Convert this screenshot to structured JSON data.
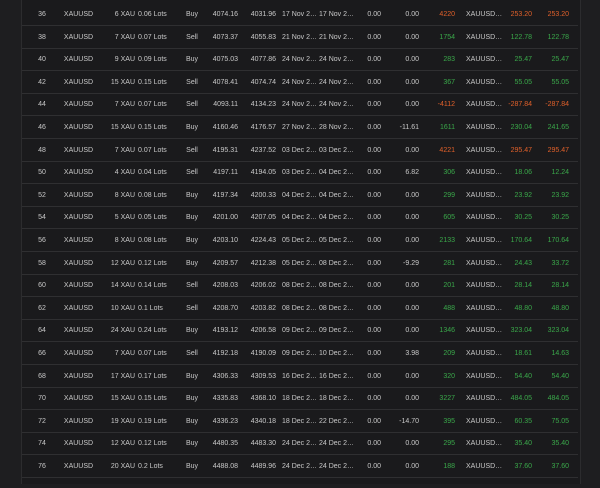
{
  "colors": {
    "positive": "#3aa84a",
    "negative": "#e0602a",
    "background": "#1a1a1c"
  },
  "rows": [
    {
      "id": "36",
      "symbol": "XAUUSD",
      "volume": "6 XAU",
      "lots": "0.06 Lots",
      "side": "Buy",
      "open": "4074.16",
      "close": "4031.96",
      "open_time": "17 Nov 2…",
      "close_time": "17 Nov 2…",
      "commission": "0.00",
      "swap": "0.00",
      "pips": "4220",
      "account": "XAUUSD…",
      "profit": "253.20",
      "net": "253.20",
      "sign": "neg"
    },
    {
      "id": "38",
      "symbol": "XAUUSD",
      "volume": "7 XAU",
      "lots": "0.07 Lots",
      "side": "Sell",
      "open": "4073.37",
      "close": "4055.83",
      "open_time": "21 Nov 2…",
      "close_time": "21 Nov 2…",
      "commission": "0.00",
      "swap": "0.00",
      "pips": "1754",
      "account": "XAUUSD…",
      "profit": "122.78",
      "net": "122.78",
      "sign": "pos"
    },
    {
      "id": "40",
      "symbol": "XAUUSD",
      "volume": "9 XAU",
      "lots": "0.09 Lots",
      "side": "Buy",
      "open": "4075.03",
      "close": "4077.86",
      "open_time": "24 Nov 2…",
      "close_time": "24 Nov 2…",
      "commission": "0.00",
      "swap": "0.00",
      "pips": "283",
      "account": "XAUUSD…",
      "profit": "25.47",
      "net": "25.47",
      "sign": "pos"
    },
    {
      "id": "42",
      "symbol": "XAUUSD",
      "volume": "15 XAU",
      "lots": "0.15 Lots",
      "side": "Sell",
      "open": "4078.41",
      "close": "4074.74",
      "open_time": "24 Nov 2…",
      "close_time": "24 Nov 2…",
      "commission": "0.00",
      "swap": "0.00",
      "pips": "367",
      "account": "XAUUSD…",
      "profit": "55.05",
      "net": "55.05",
      "sign": "pos"
    },
    {
      "id": "44",
      "symbol": "XAUUSD",
      "volume": "7 XAU",
      "lots": "0.07 Lots",
      "side": "Sell",
      "open": "4093.11",
      "close": "4134.23",
      "open_time": "24 Nov 2…",
      "close_time": "24 Nov 2…",
      "commission": "0.00",
      "swap": "0.00",
      "pips": "-4112",
      "account": "XAUUSD…",
      "profit": "-287.84",
      "net": "-287.84",
      "sign": "neg"
    },
    {
      "id": "46",
      "symbol": "XAUUSD",
      "volume": "15 XAU",
      "lots": "0.15 Lots",
      "side": "Buy",
      "open": "4160.46",
      "close": "4176.57",
      "open_time": "27 Nov 2…",
      "close_time": "28 Nov 2…",
      "commission": "0.00",
      "swap": "-11.61",
      "pips": "1611",
      "account": "XAUUSD…",
      "profit": "230.04",
      "net": "241.65",
      "sign": "pos"
    },
    {
      "id": "48",
      "symbol": "XAUUSD",
      "volume": "7 XAU",
      "lots": "0.07 Lots",
      "side": "Sell",
      "open": "4195.31",
      "close": "4237.52",
      "open_time": "03 Dec 2…",
      "close_time": "03 Dec 2…",
      "commission": "0.00",
      "swap": "0.00",
      "pips": "4221",
      "account": "XAUUSD…",
      "profit": "295.47",
      "net": "295.47",
      "sign": "neg"
    },
    {
      "id": "50",
      "symbol": "XAUUSD",
      "volume": "4 XAU",
      "lots": "0.04 Lots",
      "side": "Sell",
      "open": "4197.11",
      "close": "4194.05",
      "open_time": "03 Dec 2…",
      "close_time": "04 Dec 2…",
      "commission": "0.00",
      "swap": "6.82",
      "pips": "306",
      "account": "XAUUSD…",
      "profit": "18.06",
      "net": "12.24",
      "sign": "pos"
    },
    {
      "id": "52",
      "symbol": "XAUUSD",
      "volume": "8 XAU",
      "lots": "0.08 Lots",
      "side": "Buy",
      "open": "4197.34",
      "close": "4200.33",
      "open_time": "04 Dec 2…",
      "close_time": "04 Dec 2…",
      "commission": "0.00",
      "swap": "0.00",
      "pips": "299",
      "account": "XAUUSD…",
      "profit": "23.92",
      "net": "23.92",
      "sign": "pos"
    },
    {
      "id": "54",
      "symbol": "XAUUSD",
      "volume": "5 XAU",
      "lots": "0.05 Lots",
      "side": "Buy",
      "open": "4201.00",
      "close": "4207.05",
      "open_time": "04 Dec 2…",
      "close_time": "04 Dec 2…",
      "commission": "0.00",
      "swap": "0.00",
      "pips": "605",
      "account": "XAUUSD…",
      "profit": "30.25",
      "net": "30.25",
      "sign": "pos"
    },
    {
      "id": "56",
      "symbol": "XAUUSD",
      "volume": "8 XAU",
      "lots": "0.08 Lots",
      "side": "Buy",
      "open": "4203.10",
      "close": "4224.43",
      "open_time": "05 Dec 2…",
      "close_time": "05 Dec 2…",
      "commission": "0.00",
      "swap": "0.00",
      "pips": "2133",
      "account": "XAUUSD…",
      "profit": "170.64",
      "net": "170.64",
      "sign": "pos"
    },
    {
      "id": "58",
      "symbol": "XAUUSD",
      "volume": "12 XAU",
      "lots": "0.12 Lots",
      "side": "Buy",
      "open": "4209.57",
      "close": "4212.38",
      "open_time": "05 Dec 2…",
      "close_time": "08 Dec 2…",
      "commission": "0.00",
      "swap": "-9.29",
      "pips": "281",
      "account": "XAUUSD…",
      "profit": "24.43",
      "net": "33.72",
      "sign": "pos"
    },
    {
      "id": "60",
      "symbol": "XAUUSD",
      "volume": "14 XAU",
      "lots": "0.14 Lots",
      "side": "Sell",
      "open": "4208.03",
      "close": "4206.02",
      "open_time": "08 Dec 2…",
      "close_time": "08 Dec 2…",
      "commission": "0.00",
      "swap": "0.00",
      "pips": "201",
      "account": "XAUUSD…",
      "profit": "28.14",
      "net": "28.14",
      "sign": "pos"
    },
    {
      "id": "62",
      "symbol": "XAUUSD",
      "volume": "10 XAU",
      "lots": "0.1 Lots",
      "side": "Sell",
      "open": "4208.70",
      "close": "4203.82",
      "open_time": "08 Dec 2…",
      "close_time": "08 Dec 2…",
      "commission": "0.00",
      "swap": "0.00",
      "pips": "488",
      "account": "XAUUSD…",
      "profit": "48.80",
      "net": "48.80",
      "sign": "pos"
    },
    {
      "id": "64",
      "symbol": "XAUUSD",
      "volume": "24 XAU",
      "lots": "0.24 Lots",
      "side": "Buy",
      "open": "4193.12",
      "close": "4206.58",
      "open_time": "09 Dec 2…",
      "close_time": "09 Dec 2…",
      "commission": "0.00",
      "swap": "0.00",
      "pips": "1346",
      "account": "XAUUSD…",
      "profit": "323.04",
      "net": "323.04",
      "sign": "pos"
    },
    {
      "id": "66",
      "symbol": "XAUUSD",
      "volume": "7 XAU",
      "lots": "0.07 Lots",
      "side": "Sell",
      "open": "4192.18",
      "close": "4190.09",
      "open_time": "09 Dec 2…",
      "close_time": "10 Dec 2…",
      "commission": "0.00",
      "swap": "3.98",
      "pips": "209",
      "account": "XAUUSD…",
      "profit": "18.61",
      "net": "14.63",
      "sign": "pos"
    },
    {
      "id": "68",
      "symbol": "XAUUSD",
      "volume": "17 XAU",
      "lots": "0.17 Lots",
      "side": "Buy",
      "open": "4306.33",
      "close": "4309.53",
      "open_time": "16 Dec 2…",
      "close_time": "16 Dec 2…",
      "commission": "0.00",
      "swap": "0.00",
      "pips": "320",
      "account": "XAUUSD…",
      "profit": "54.40",
      "net": "54.40",
      "sign": "pos"
    },
    {
      "id": "70",
      "symbol": "XAUUSD",
      "volume": "15 XAU",
      "lots": "0.15 Lots",
      "side": "Buy",
      "open": "4335.83",
      "close": "4368.10",
      "open_time": "18 Dec 2…",
      "close_time": "18 Dec 2…",
      "commission": "0.00",
      "swap": "0.00",
      "pips": "3227",
      "account": "XAUUSD…",
      "profit": "484.05",
      "net": "484.05",
      "sign": "pos"
    },
    {
      "id": "72",
      "symbol": "XAUUSD",
      "volume": "19 XAU",
      "lots": "0.19 Lots",
      "side": "Buy",
      "open": "4336.23",
      "close": "4340.18",
      "open_time": "18 Dec 2…",
      "close_time": "22 Dec 2…",
      "commission": "0.00",
      "swap": "-14.70",
      "pips": "395",
      "account": "XAUUSD…",
      "profit": "60.35",
      "net": "75.05",
      "sign": "pos"
    },
    {
      "id": "74",
      "symbol": "XAUUSD",
      "volume": "12 XAU",
      "lots": "0.12 Lots",
      "side": "Buy",
      "open": "4480.35",
      "close": "4483.30",
      "open_time": "24 Dec 2…",
      "close_time": "24 Dec 2…",
      "commission": "0.00",
      "swap": "0.00",
      "pips": "295",
      "account": "XAUUSD…",
      "profit": "35.40",
      "net": "35.40",
      "sign": "pos"
    },
    {
      "id": "76",
      "symbol": "XAUUSD",
      "volume": "20 XAU",
      "lots": "0.2 Lots",
      "side": "Buy",
      "open": "4488.08",
      "close": "4489.96",
      "open_time": "24 Dec 2…",
      "close_time": "24 Dec 2…",
      "commission": "0.00",
      "swap": "0.00",
      "pips": "188",
      "account": "XAUUSD…",
      "profit": "37.60",
      "net": "37.60",
      "sign": "pos"
    }
  ]
}
